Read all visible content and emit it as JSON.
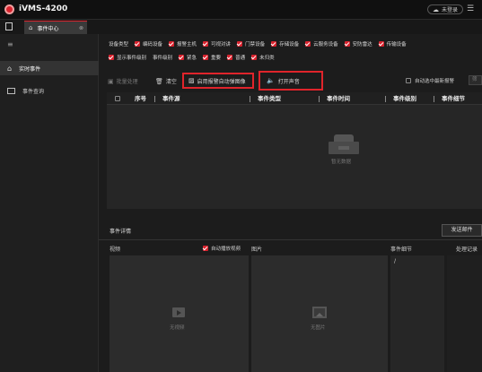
{
  "app": {
    "title": "iVMS-4200",
    "user_status": "未登录"
  },
  "tabs": [
    {
      "label": "事件中心"
    }
  ],
  "sidebar": {
    "items": [
      {
        "label": "实时事件",
        "active": true
      },
      {
        "label": "事件查询",
        "active": false
      }
    ]
  },
  "filters": {
    "row1": [
      "设备类型",
      "编码设备",
      "报警主机",
      "可视对讲",
      "门禁设备",
      "存储设备",
      "云服务设备",
      "安防雷达",
      "传输设备"
    ],
    "row2": [
      "显示事件级别",
      "事件级别",
      "紧急",
      "重要",
      "普通",
      "未归类"
    ]
  },
  "toolbar": {
    "batch": "批量处理",
    "clear": "清空",
    "enable_capture": "启用报警自动弹图像",
    "open_sound": "打开声音",
    "auto_select_latest": "自动选中最新报警",
    "filter_btn": "筛选"
  },
  "table": {
    "columns": [
      "序号",
      "事件源",
      "事件类型",
      "事件时间",
      "事件级别",
      "事件细节"
    ],
    "empty_text": "暂无数据"
  },
  "details": {
    "title": "事件详情",
    "send_email": "发送邮件",
    "video_label": "视频",
    "auto_play_label": "自动播放视频",
    "picture_label": "图片",
    "event_detail_label": "事件细节",
    "record_label": "处理记录",
    "detail_value": "/",
    "no_video": "无视频",
    "no_picture": "无图片"
  },
  "colors": {
    "accent": "#d9232e",
    "highlight_box": "#e0242b"
  }
}
